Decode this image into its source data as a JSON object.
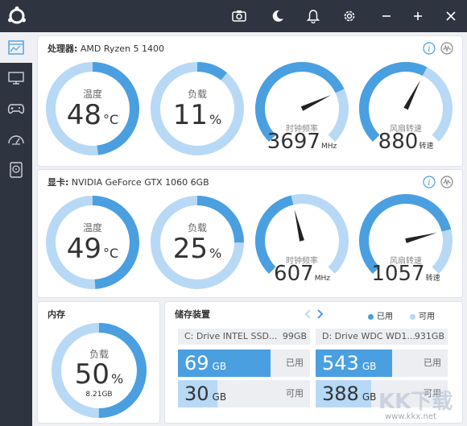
{
  "colors": {
    "accent": "#4a9fe0",
    "light": "#b8d9f5",
    "dark": "#2e3440"
  },
  "titlebar": {
    "icons": [
      "camera-icon",
      "moon-icon",
      "bell-icon",
      "gear-icon",
      "minimize-icon",
      "maximize-icon",
      "close-icon"
    ]
  },
  "sidebar": {
    "items": [
      "dashboard-icon",
      "monitor-icon",
      "gamepad-icon",
      "speedometer-icon",
      "disk-icon"
    ]
  },
  "cpu": {
    "label": "处理器:",
    "name": "AMD Ryzen 5 1400",
    "temp": {
      "label": "温度",
      "value": "48",
      "unit": "°C",
      "fraction": 0.48
    },
    "load": {
      "label": "负载",
      "value": "11",
      "unit": "%",
      "fraction": 0.11
    },
    "clock": {
      "label": "时钟频率",
      "value": "3697",
      "unit": "MHz",
      "fraction": 0.74
    },
    "fan": {
      "label": "风扇转速",
      "value": "880",
      "unit": "转速",
      "fraction": 0.6
    }
  },
  "gpu": {
    "label": "显卡:",
    "name": "NVIDIA GeForce GTX 1060 6GB",
    "temp": {
      "label": "温度",
      "value": "49",
      "unit": "°C",
      "fraction": 0.49
    },
    "load": {
      "label": "负载",
      "value": "25",
      "unit": "%",
      "fraction": 0.25
    },
    "clock": {
      "label": "时钟频率",
      "value": "607",
      "unit": "MHz",
      "fraction": 0.45
    },
    "fan": {
      "label": "风扇转速",
      "value": "1057",
      "unit": "转速",
      "fraction": 0.78
    }
  },
  "memory": {
    "title": "内存",
    "load": {
      "label": "负载",
      "value": "50",
      "unit": "%",
      "sub": "8.21GB",
      "fraction": 0.5
    }
  },
  "storage": {
    "title": "储存装置",
    "legend_used": "已用",
    "legend_free": "可用",
    "drives": [
      {
        "name": "C: Drive INTEL SSD...",
        "size": "99GB",
        "used": "69",
        "used_unit": "GB",
        "used_tag": "已用",
        "free": "30",
        "free_unit": "GB",
        "free_tag": "可用",
        "used_fraction": 0.7
      },
      {
        "name": "D: Drive WDC WD1...",
        "size": "931GB",
        "used": "543",
        "used_unit": "GB",
        "used_tag": "已用",
        "free": "388",
        "free_unit": "GB",
        "free_tag": "可用",
        "used_fraction": 0.58
      }
    ]
  },
  "watermark": {
    "brand": "KK下载",
    "url": "www.kkx.net"
  }
}
